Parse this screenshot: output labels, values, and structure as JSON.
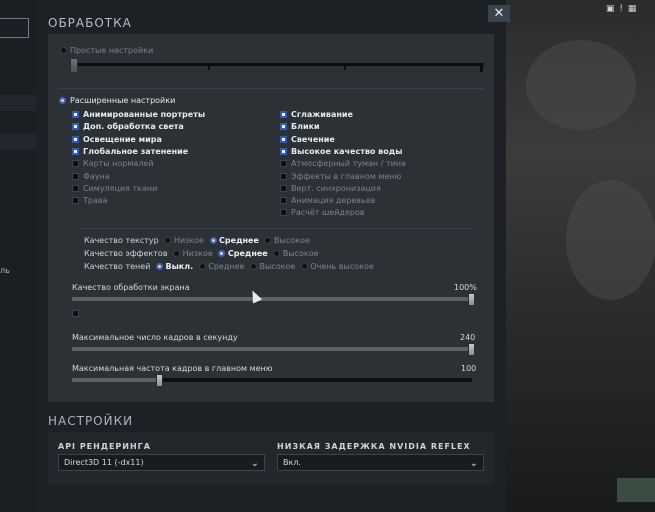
{
  "window": {
    "title": "ОБРАБОТКА",
    "close_symbol": "✕"
  },
  "background": {
    "left_text": "ль",
    "right_text": "▣ ! ▦"
  },
  "simple": {
    "label": "Простые настройки"
  },
  "advanced": {
    "label": "Расширенные настройки",
    "left_checks": [
      {
        "label": "Анимированные портреты",
        "checked": true
      },
      {
        "label": "Доп. обработка света",
        "checked": true
      },
      {
        "label": "Освещение мира",
        "checked": true
      },
      {
        "label": "Глобальное затенение",
        "checked": true
      },
      {
        "label": "Карты нормалей",
        "checked": false
      },
      {
        "label": "Фауна",
        "checked": false
      },
      {
        "label": "Симуляция ткани",
        "checked": false
      },
      {
        "label": "Трава",
        "checked": false
      }
    ],
    "right_checks": [
      {
        "label": "Сглаживание",
        "checked": true
      },
      {
        "label": "Блики",
        "checked": true
      },
      {
        "label": "Свечение",
        "checked": true
      },
      {
        "label": "Высокое качество воды",
        "checked": true
      },
      {
        "label": "Атмосферный туман / тина",
        "checked": false
      },
      {
        "label": "Эффекты в главном меню",
        "checked": false
      },
      {
        "label": "Верт. синхронизация",
        "checked": false
      },
      {
        "label": "Анимация деревьев",
        "checked": false
      },
      {
        "label": "Расчёт шейдеров",
        "checked": false
      }
    ]
  },
  "quality": {
    "texture": {
      "label": "Качество текстур",
      "options": [
        "Низкое",
        "Среднее",
        "Высокое"
      ],
      "selected": "Среднее"
    },
    "effects": {
      "label": "Качество эффектов",
      "options": [
        "Низкое",
        "Среднее",
        "Высокое"
      ],
      "selected": "Среднее"
    },
    "shadows": {
      "label": "Качество теней",
      "options": [
        "Выкл.",
        "Среднее",
        "Высокое",
        "Очень высокое"
      ],
      "selected": "Выкл."
    }
  },
  "sliders": {
    "screen": {
      "label": "Качество обработки экрана",
      "value_text": "100%",
      "fraction": 1.0
    },
    "fps": {
      "label": "Максимальное число кадров в секунду",
      "value_text": "240",
      "fraction": 1.0
    },
    "menu_fps": {
      "label": "Максимальная частота кадров в главном меню",
      "value_text": "100",
      "fraction": 0.22
    }
  },
  "settings": {
    "title": "НАСТРОЙКИ",
    "render_api": {
      "label": "API РЕНДЕРИНГА",
      "value": "Direct3D 11 (-dx11)"
    },
    "reflex": {
      "label": "НИЗКАЯ ЗАДЕРЖКА NVIDIA REFLEX",
      "value": "Вкл."
    }
  },
  "colors": {
    "accent": "#3658b8",
    "panel": "#2c3136",
    "window": "#1d2024"
  }
}
